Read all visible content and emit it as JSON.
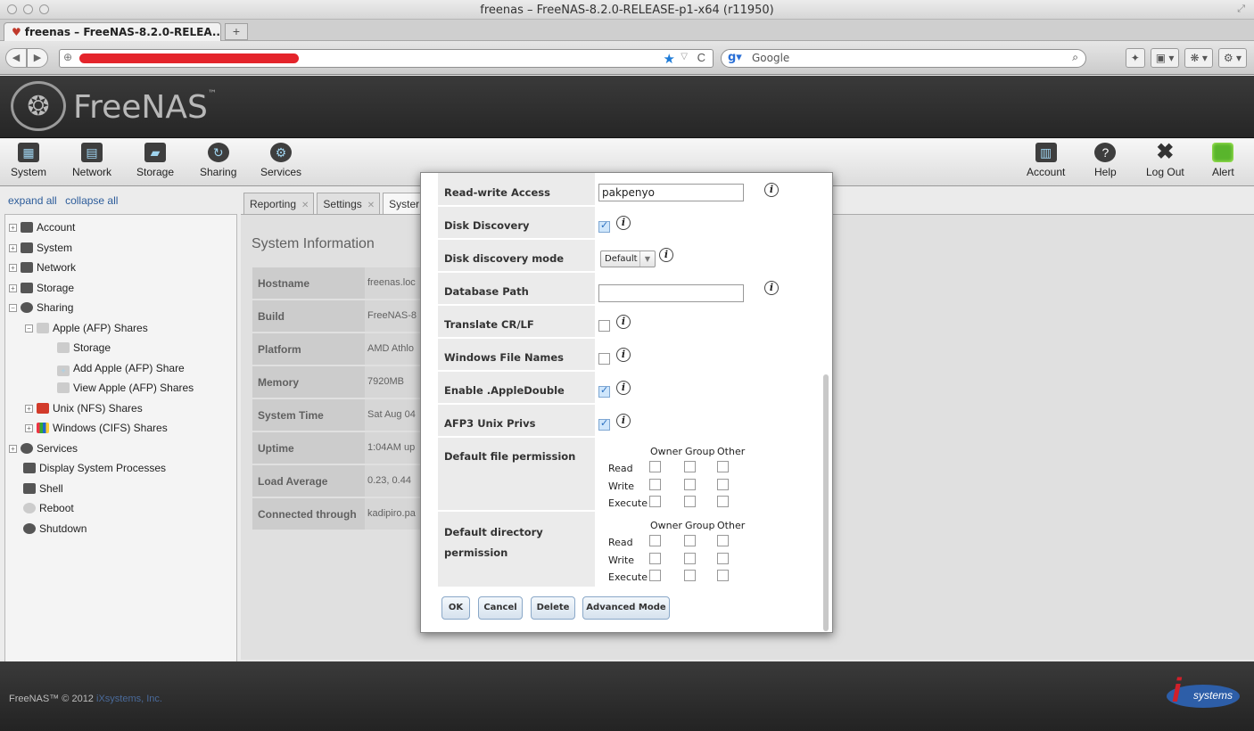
{
  "browser": {
    "window_title": "freenas – FreeNAS-8.2.0-RELEASE-p1-x64 (r11950)",
    "tab_title": "freenas – FreeNAS-8.2.0-RELEA...",
    "new_tab": "+",
    "search_engine": "Google"
  },
  "header": {
    "logo_text": "FreeNAS",
    "trademark": "™"
  },
  "toolbar": {
    "left": [
      {
        "label": "System",
        "icon": "system-icon"
      },
      {
        "label": "Network",
        "icon": "network-icon"
      },
      {
        "label": "Storage",
        "icon": "storage-icon"
      },
      {
        "label": "Sharing",
        "icon": "sharing-icon"
      },
      {
        "label": "Services",
        "icon": "services-icon"
      }
    ],
    "right": [
      {
        "label": "Account",
        "icon": "account-icon"
      },
      {
        "label": "Help",
        "icon": "help-icon"
      },
      {
        "label": "Log Out",
        "icon": "logout-icon"
      },
      {
        "label": "Alert",
        "icon": "alert-icon"
      }
    ]
  },
  "sidebar": {
    "expand_all": "expand all",
    "collapse_all": "collapse all",
    "tree": [
      {
        "label": "Account"
      },
      {
        "label": "System"
      },
      {
        "label": "Network"
      },
      {
        "label": "Storage"
      },
      {
        "label": "Sharing"
      },
      {
        "label": "Apple (AFP) Shares"
      },
      {
        "label": "Storage"
      },
      {
        "label": "Add Apple (AFP) Share"
      },
      {
        "label": "View Apple (AFP) Shares"
      },
      {
        "label": "Unix (NFS) Shares"
      },
      {
        "label": "Windows (CIFS) Shares"
      },
      {
        "label": "Services"
      },
      {
        "label": "Display System Processes"
      },
      {
        "label": "Shell"
      },
      {
        "label": "Reboot"
      },
      {
        "label": "Shutdown"
      }
    ]
  },
  "main": {
    "tabs": [
      {
        "label": "Reporting"
      },
      {
        "label": "Settings"
      },
      {
        "label": "Syster"
      }
    ],
    "title": "System Information",
    "rows": [
      {
        "key": "Hostname",
        "value": "freenas.loc"
      },
      {
        "key": "Build",
        "value": "FreeNAS-8"
      },
      {
        "key": "Platform",
        "value": "AMD Athlo"
      },
      {
        "key": "Memory",
        "value": "7920MB"
      },
      {
        "key": "System Time",
        "value": "Sat Aug 04"
      },
      {
        "key": "Uptime",
        "value": "1:04AM up"
      },
      {
        "key": "Load Average",
        "value": "0.23, 0.44"
      },
      {
        "key": "Connected through",
        "value": "kadipiro.pa"
      }
    ]
  },
  "modal": {
    "fields": {
      "rw_access": {
        "label": "Read-write Access",
        "value": "pakpenyo"
      },
      "disk_discovery": {
        "label": "Disk Discovery",
        "checked": true
      },
      "disk_discovery_mode": {
        "label": "Disk discovery mode",
        "value": "Default"
      },
      "database_path": {
        "label": "Database Path",
        "value": ""
      },
      "translate_crlf": {
        "label": "Translate CR/LF",
        "checked": false
      },
      "windows_file_names": {
        "label": "Windows File Names",
        "checked": false
      },
      "enable_appledouble": {
        "label": "Enable .AppleDouble",
        "checked": true
      },
      "afp3_unix_privs": {
        "label": "AFP3 Unix Privs",
        "checked": true
      },
      "default_file_permission": {
        "label": "Default file permission"
      },
      "default_dir_permission": {
        "label": "Default directory permission"
      }
    },
    "perm_columns": [
      "Owner",
      "Group",
      "Other"
    ],
    "perm_rows": [
      "Read",
      "Write",
      "Execute"
    ],
    "buttons": {
      "ok": "OK",
      "cancel": "Cancel",
      "delete": "Delete",
      "advanced": "Advanced Mode"
    }
  },
  "footer": {
    "copyright": "FreeNAS™ © 2012",
    "company": "iXsystems, Inc.",
    "logo_text": "systems"
  }
}
